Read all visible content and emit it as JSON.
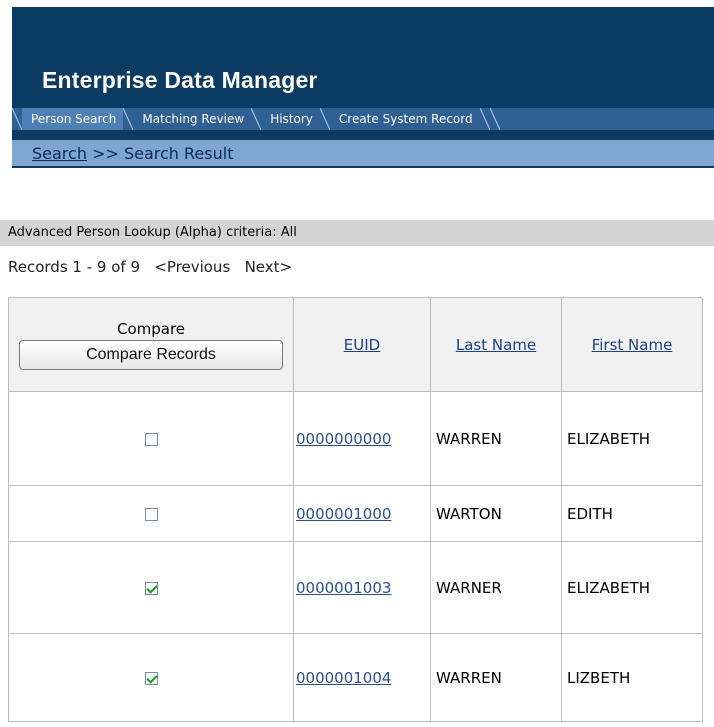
{
  "app": {
    "title": "Enterprise Data Manager"
  },
  "tabs": [
    {
      "label": "Person Search",
      "active": true
    },
    {
      "label": "Matching Review",
      "active": false
    },
    {
      "label": "History",
      "active": false
    },
    {
      "label": "Create System Record",
      "active": false
    }
  ],
  "breadcrumb": {
    "link": "Search",
    "separator": ">>",
    "current": "Search Result"
  },
  "criteria": {
    "text": "Advanced Person Lookup (Alpha) criteria: All"
  },
  "pager": {
    "records": "Records 1 - 9 of 9",
    "previous": "<Previous",
    "next": "Next>"
  },
  "table": {
    "compare_label": "Compare",
    "compare_button": "Compare Records",
    "headers": {
      "euid": "EUID",
      "last_name": "Last Name",
      "first_name": "First Name"
    },
    "rows": [
      {
        "checked": false,
        "euid": "0000000000",
        "last_name": "WARREN",
        "first_name": "ELIZABETH"
      },
      {
        "checked": false,
        "euid": "0000001000",
        "last_name": "WARTON",
        "first_name": "EDITH"
      },
      {
        "checked": true,
        "euid": "0000001003",
        "last_name": "WARNER",
        "first_name": "ELIZABETH"
      },
      {
        "checked": true,
        "euid": "0000001004",
        "last_name": "WARREN",
        "first_name": "LIZBETH"
      }
    ]
  }
}
